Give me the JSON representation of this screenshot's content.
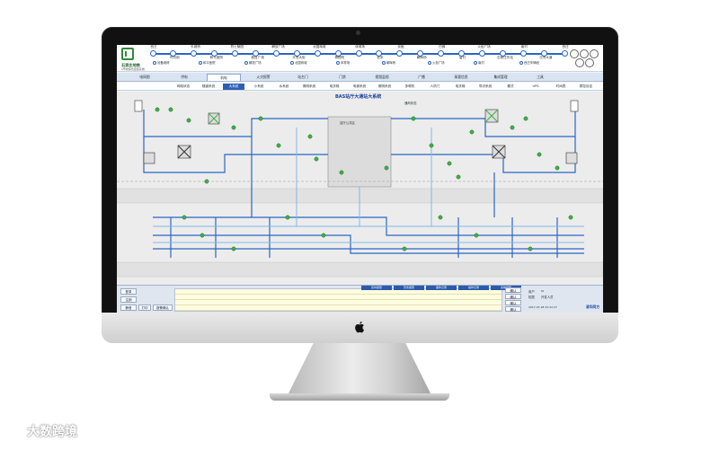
{
  "station_line": {
    "stations": [
      {
        "name": "西王",
        "top": "西王"
      },
      {
        "name": "时光街",
        "top": "时光街"
      },
      {
        "name": "长城桥",
        "top": "长城桥"
      },
      {
        "name": "和平医院",
        "top": "和平医院"
      },
      {
        "name": "烈士陵园",
        "top": "烈士陵园"
      },
      {
        "name": "新百广场",
        "top": "新百广场"
      },
      {
        "name": "解放广场",
        "top": "解放广场"
      },
      {
        "name": "平安大街",
        "top": "平安大街"
      },
      {
        "name": "北国商城",
        "top": "北国商城"
      },
      {
        "name": "博物院",
        "top": "博物院"
      },
      {
        "name": "体育场",
        "top": "体育场"
      },
      {
        "name": "北宋",
        "top": "北宋"
      },
      {
        "name": "谈固",
        "top": "谈固"
      },
      {
        "name": "朝晖桥",
        "top": "朝晖桥"
      },
      {
        "name": "白佛",
        "top": "白佛"
      },
      {
        "name": "留村",
        "top": "留村"
      },
      {
        "name": "火炬广场",
        "top": "火炬广场"
      },
      {
        "name": "石家庄东站",
        "top": "石家庄东站"
      },
      {
        "name": "南村",
        "top": "南村"
      },
      {
        "name": "洨河大道",
        "top": "洨河大道"
      },
      {
        "name": "西庄",
        "top": "西庄"
      }
    ]
  },
  "header": {
    "logo_title": "石家庄地铁",
    "logo_subtitle": "1号线综合监控系统",
    "legend": [
      {
        "label": "设备维修"
      },
      {
        "label": "和平医院"
      },
      {
        "label": "解放广场"
      },
      {
        "label": "北国商城"
      },
      {
        "label": "体育场"
      },
      {
        "label": "朝晖桥"
      },
      {
        "label": "火炬广场"
      },
      {
        "label": "南村"
      },
      {
        "label": "西庄车辆段"
      }
    ]
  },
  "nav": {
    "items": [
      "电网图",
      "供电",
      "机电",
      "火灾报警",
      "站台门",
      "门禁",
      "视频监视",
      "广播",
      "乘客信息",
      "集成管理",
      "工具"
    ],
    "active_index": 2
  },
  "subnav": {
    "items": [
      "网络状态",
      "隧道系统",
      "大系统",
      "小系统",
      "水系统",
      "照明系统",
      "电扶梯",
      "电梯系统",
      "照明系统",
      "多联机",
      "人防门",
      "电扶梯",
      "导识系统",
      "模式",
      "UPS",
      "时间表",
      "群控设定"
    ],
    "active_index": 2
  },
  "diagram": {
    "title": "BAS站厅大通站大系统",
    "center_box_label": "站厅公共区",
    "mode_label": "通风状态"
  },
  "bottom": {
    "buttons": {
      "login": "登录",
      "logout": "注销",
      "mute": "静音",
      "print": "打印",
      "confirm": "报警确认"
    },
    "tabs": [
      "实时报警",
      "历史报警",
      "事件记录",
      "操作记录",
      "系统报警"
    ],
    "user_label": "用户",
    "user_value": "sr",
    "role_label": "权限",
    "role_value": "开发人员",
    "datetime": "2017-07-28 23:22:27",
    "brand": "清华同方",
    "side_buttons": [
      "确认",
      "确认",
      "确认",
      "确认"
    ]
  },
  "watermark": {
    "text": "大数跨境"
  },
  "colors": {
    "pipe_blue": "#2a66c4",
    "pipe_light": "#7fb7e8",
    "status_green": "#3cb043",
    "active_tab": "#2f5fb4"
  }
}
